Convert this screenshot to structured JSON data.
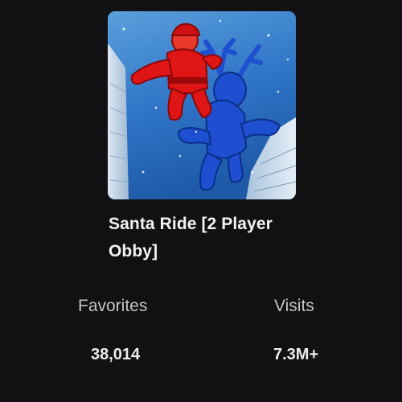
{
  "game": {
    "title": "Santa Ride [2 Player Obby]",
    "thumbnail_icon": "santa-and-reindeer-thumbnail"
  },
  "stats": {
    "favorites_label": "Favorites",
    "favorites_value": "38,014",
    "visits_label": "Visits",
    "visits_value": "7.3M+"
  },
  "colors": {
    "background": "#111114",
    "text_primary": "#f2f2f4",
    "text_secondary": "#c3c3c8",
    "santa_red": "#e01515",
    "reindeer_blue": "#1d4fd0",
    "sky_blue": "#2f74c6"
  }
}
